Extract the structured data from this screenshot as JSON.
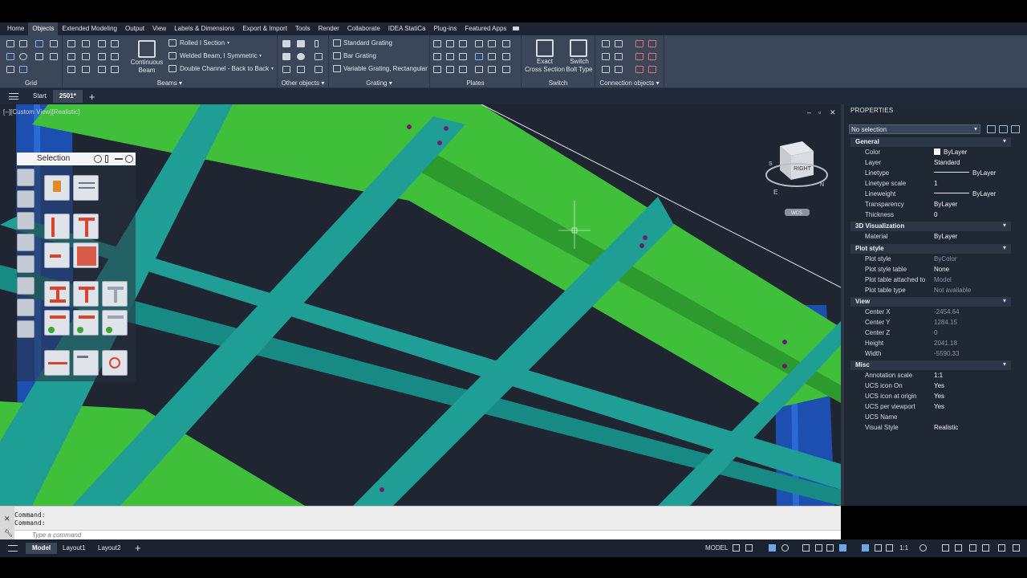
{
  "ribbon_tabs": [
    "Home",
    "Objects",
    "Extended Modeling",
    "Output",
    "View",
    "Labels & Dimensions",
    "Export & Import",
    "Tools",
    "Render",
    "Collaborate",
    "IDEA StatiCa",
    "Plug-ins",
    "Featured Apps"
  ],
  "active_tab": "Objects",
  "panels": {
    "grid": "Grid",
    "beams": "Beams",
    "other": "Other objects",
    "grating": "Grating",
    "plates": "Plates",
    "switch": "Switch",
    "connection": "Connection objects"
  },
  "beams": {
    "continuous_1": "Continuous",
    "continuous_2": "Beam",
    "rolled": "Rolled I Section",
    "welded": "Welded Beam, I Symmetric",
    "double": "Double Channel - Back to Back"
  },
  "grating": {
    "standard": "Standard Grating",
    "bar": "Bar Grating",
    "variable": "Variable Grating, Rectangular"
  },
  "switch": {
    "exact_1": "Exact",
    "exact_2": "Cross Section",
    "bolt_1": "Switch",
    "bolt_2": "Bolt Type"
  },
  "doc_tabs": [
    "Start",
    "2501*"
  ],
  "viewport": {
    "label": "[−][Custom View][Realistic]",
    "viewcube_face": "RIGHT",
    "wcs": "WCS",
    "compass": {
      "s": "S",
      "e": "E",
      "n": "N"
    }
  },
  "selection_palette": {
    "title": "Selection"
  },
  "properties": {
    "title": "PROPERTIES",
    "selection": "No selection",
    "sections": {
      "general": {
        "title": "General",
        "rows": [
          {
            "k": "Color",
            "v": "ByLayer"
          },
          {
            "k": "Layer",
            "v": "Standard"
          },
          {
            "k": "Linetype",
            "v": "ByLayer"
          },
          {
            "k": "Linetype scale",
            "v": "1"
          },
          {
            "k": "Lineweight",
            "v": "ByLayer"
          },
          {
            "k": "Transparency",
            "v": "ByLayer"
          },
          {
            "k": "Thickness",
            "v": "0"
          }
        ]
      },
      "viz": {
        "title": "3D Visualization",
        "rows": [
          {
            "k": "Material",
            "v": "ByLayer"
          }
        ]
      },
      "plot": {
        "title": "Plot style",
        "rows": [
          {
            "k": "Plot style",
            "v": "ByColor"
          },
          {
            "k": "Plot style table",
            "v": "None"
          },
          {
            "k": "Plot table attached to",
            "v": "Model"
          },
          {
            "k": "Plot table type",
            "v": "Not available"
          }
        ]
      },
      "view": {
        "title": "View",
        "rows": [
          {
            "k": "Center X",
            "v": "-2454.64"
          },
          {
            "k": "Center Y",
            "v": "1284.15"
          },
          {
            "k": "Center Z",
            "v": "0"
          },
          {
            "k": "Height",
            "v": "2041.18"
          },
          {
            "k": "Width",
            "v": "-5590.33"
          }
        ]
      },
      "misc": {
        "title": "Misc",
        "rows": [
          {
            "k": "Annotation scale",
            "v": "1:1"
          },
          {
            "k": "UCS icon On",
            "v": "Yes"
          },
          {
            "k": "UCS icon at origin",
            "v": "Yes"
          },
          {
            "k": "UCS per viewport",
            "v": "Yes"
          },
          {
            "k": "UCS Name",
            "v": ""
          },
          {
            "k": "Visual Style",
            "v": "Realistic"
          }
        ]
      }
    }
  },
  "command": {
    "line1": "Command:",
    "line2": "Command:",
    "placeholder": "Type a command"
  },
  "layout_tabs": [
    "Model",
    "Layout1",
    "Layout2"
  ],
  "status": {
    "model": "MODEL",
    "scale": "1:1"
  },
  "colors": {
    "steel_green": "#3fbf3a",
    "steel_teal": "#1e9e95",
    "column_blue": "#1d4fb0",
    "bolt": "#6a1f6e",
    "viewport_bg": "#1f2631"
  }
}
